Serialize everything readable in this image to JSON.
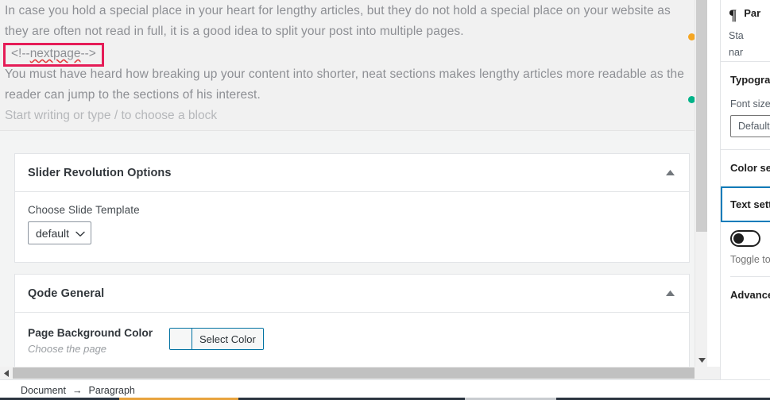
{
  "editor": {
    "paragraph_1": "In case you hold a special place in your heart for lengthy articles, but they do not hold a special place on your website as they are often not read in full, it is a good idea to split your post into multiple pages.",
    "nextpage_tag_prefix": "<!--",
    "nextpage_tag_word": "nextpage",
    "nextpage_tag_suffix": "-->",
    "paragraph_2": "You must have heard how breaking up your content into shorter, neat sections makes lengthy articles more readable as the reader can jump to the sections of his interest.",
    "placeholder": "Start writing or type / to choose a block",
    "highlight_color": "#e51c57",
    "dot_orange_color": "#f5a623",
    "dot_green_color": "#00b388"
  },
  "metaboxes": [
    {
      "title": "Slider Revolution Options",
      "collapse_icon": "caret-up-icon",
      "field_label": "Choose Slide Template",
      "select_value": "default"
    },
    {
      "title": "Qode General",
      "collapse_icon": "caret-up-icon",
      "field_label": "Page Background Color",
      "field_description": "Choose the page",
      "color_button_label": "Select Color"
    }
  ],
  "sidebar": {
    "block_card": {
      "icon": "paragraph-pilcrow-icon",
      "name": "Par",
      "description_line_1": "Sta",
      "description_line_2": "nar"
    },
    "typography": {
      "title": "Typogra",
      "font_size_label": "Font size",
      "font_size_value": "Default"
    },
    "color_settings_title": "Color se",
    "text_settings_title": "Text sett",
    "text_settings_focus_color": "#007cba",
    "toggle": {
      "state": "off",
      "help_text": "Toggle to"
    },
    "advanced_title": "Advance"
  },
  "statusbar": {
    "breadcrumb": [
      {
        "label": "Document"
      },
      {
        "label": "Paragraph"
      }
    ],
    "separator": "→"
  },
  "scrollbars": {
    "vertical": {
      "up_arrow": "caret-up-icon",
      "down_arrow": "caret-down-icon"
    },
    "horizontal": {
      "left_arrow": "caret-left-icon",
      "right_arrow": "caret-right-icon"
    }
  }
}
